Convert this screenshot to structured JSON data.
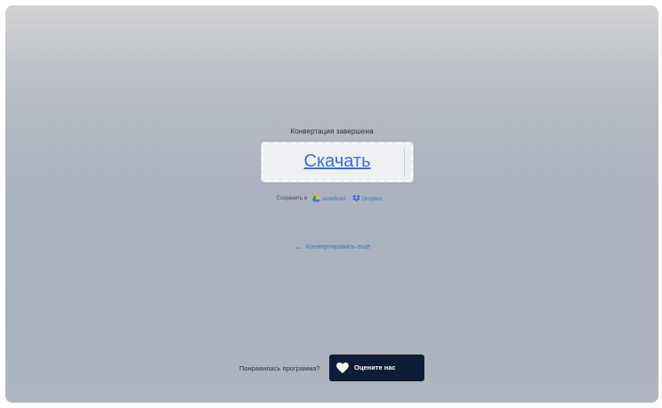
{
  "conversion": {
    "status_text": "Конвертация завершена",
    "download_label": "Скачать"
  },
  "save_to": {
    "prefix": "Сохранить в",
    "services": [
      {
        "label": "undefined",
        "icon": "google-drive-icon"
      },
      {
        "label": "Dropbox",
        "icon": "dropbox-icon"
      }
    ]
  },
  "back_link": {
    "arrow": "←",
    "label": "Конвертировать ещё"
  },
  "rating": {
    "question": "Понравилась программа?",
    "button_label": "Оцените нас",
    "icon": "heart-icon"
  },
  "colors": {
    "link": "#3d73d6",
    "rate_button_bg": "#0f1c35",
    "download_bg": "#eef0f3"
  }
}
